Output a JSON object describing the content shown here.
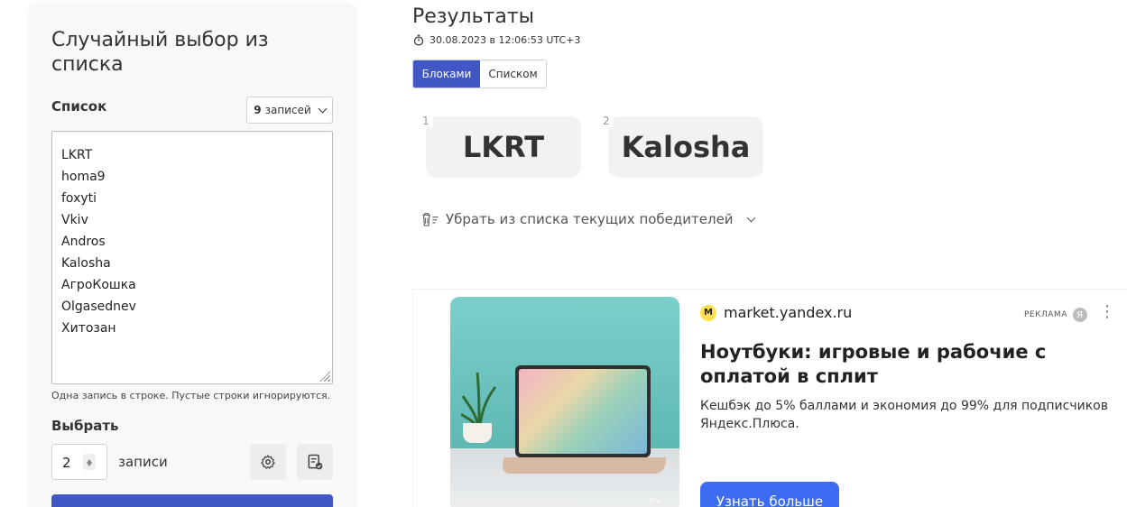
{
  "generator": {
    "title": "Случайный выбор из списка",
    "list_label": "Список",
    "count_value": "9",
    "count_unit": "записей",
    "entries": [
      "LKRT",
      "homa9",
      "foxyti",
      "Vkiv",
      "Andros",
      "Kalosha",
      "АгроКошка",
      "Olgasednev",
      "Хитозан"
    ],
    "hint": "Одна запись в строке. Пустые строки игнорируются.",
    "pick_label": "Выбрать",
    "pick_count": "2",
    "pick_unit": "записи"
  },
  "results": {
    "title": "Результаты",
    "timestamp": "30.08.2023 в 12:06:53 UTC+3",
    "view_blocks": "Блоками",
    "view_list": "Списком",
    "winners": [
      {
        "num": "1",
        "name": "LKRT"
      },
      {
        "num": "2",
        "name": "Kalosha"
      }
    ],
    "remove_label": "Убрать из списка текущих победителей"
  },
  "ad": {
    "domain": "market.yandex.ru",
    "label": "РЕКЛАМА",
    "ya_letter": "Я",
    "headline": "Ноутбуки: игровые и рабочие с оплатой в сплит",
    "text": "Кешбэк до 5% баллами и экономия до 99% для подписчиков Яндекс.Плюса.",
    "cta": "Узнать больше",
    "age": "0+"
  },
  "colors": {
    "accent": "#4257c6",
    "cta": "#3d6cf2",
    "card_bg": "#f8f8f8"
  }
}
